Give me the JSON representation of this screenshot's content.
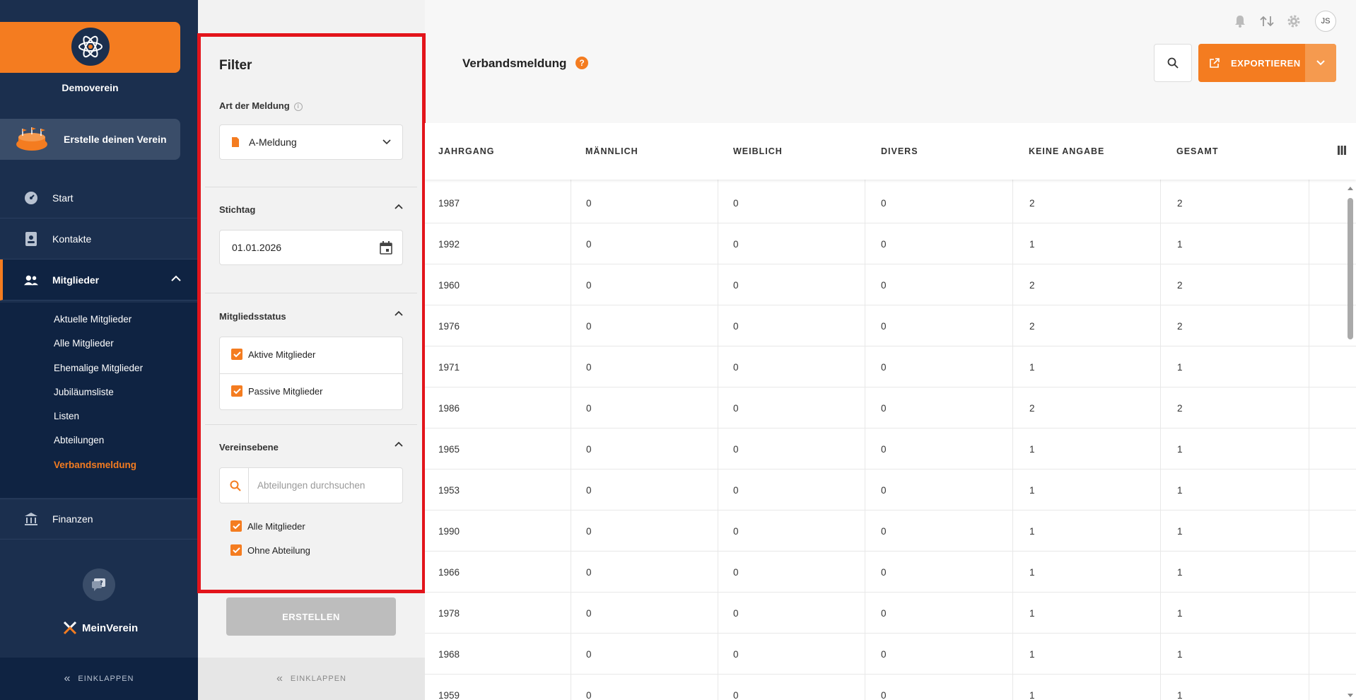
{
  "sidebar": {
    "org_name": "Demoverein",
    "create_club_label": "Erstelle deinen Verein",
    "nav": [
      {
        "label": "Start",
        "icon": "speedometer-icon"
      },
      {
        "label": "Kontakte",
        "icon": "contact-card-icon"
      },
      {
        "label": "Mitglieder",
        "icon": "people-icon"
      },
      {
        "label": "Finanzen",
        "icon": "bank-icon"
      }
    ],
    "submenu": [
      "Aktuelle Mitglieder",
      "Alle Mitglieder",
      "Ehemalige Mitglieder",
      "Jubiläumsliste",
      "Listen",
      "Abteilungen",
      "Verbandsmeldung"
    ],
    "brand_label": "MeinVerein",
    "collapse_label": "EINKLAPPEN"
  },
  "filter": {
    "title": "Filter",
    "report_type_label": "Art der Meldung",
    "report_type_value": "A-Meldung",
    "date_label": "Stichtag",
    "date_value": "01.01.2026",
    "status_label": "Mitgliedsstatus",
    "status_options": [
      "Aktive Mitglieder",
      "Passive Mitglieder"
    ],
    "level_label": "Vereinsebene",
    "search_placeholder": "Abteilungen durchsuchen",
    "department_options": [
      "Alle Mitglieder",
      "Ohne Abteilung"
    ],
    "create_button": "ERSTELLEN",
    "collapse_label": "EINKLAPPEN"
  },
  "header": {
    "page_title": "Verbandsmeldung",
    "help": "?",
    "avatar_initials": "JS",
    "export_label": "EXPORTIEREN"
  },
  "table": {
    "columns": [
      "JAHRGANG",
      "MÄNNLICH",
      "WEIBLICH",
      "DIVERS",
      "KEINE ANGABE",
      "GESAMT"
    ],
    "rows": [
      [
        "1987",
        "0",
        "0",
        "0",
        "2",
        "2"
      ],
      [
        "1992",
        "0",
        "0",
        "0",
        "1",
        "1"
      ],
      [
        "1960",
        "0",
        "0",
        "0",
        "2",
        "2"
      ],
      [
        "1976",
        "0",
        "0",
        "0",
        "2",
        "2"
      ],
      [
        "1971",
        "0",
        "0",
        "0",
        "1",
        "1"
      ],
      [
        "1986",
        "0",
        "0",
        "0",
        "2",
        "2"
      ],
      [
        "1965",
        "0",
        "0",
        "0",
        "1",
        "1"
      ],
      [
        "1953",
        "0",
        "0",
        "0",
        "1",
        "1"
      ],
      [
        "1990",
        "0",
        "0",
        "0",
        "1",
        "1"
      ],
      [
        "1966",
        "0",
        "0",
        "0",
        "1",
        "1"
      ],
      [
        "1978",
        "0",
        "0",
        "0",
        "1",
        "1"
      ],
      [
        "1968",
        "0",
        "0",
        "0",
        "1",
        "1"
      ],
      [
        "1959",
        "0",
        "0",
        "0",
        "1",
        "1"
      ]
    ]
  },
  "colors": {
    "accent": "#f47c20",
    "sidebar_bg": "#1b2f4e",
    "highlight_frame": "#e3141b"
  }
}
